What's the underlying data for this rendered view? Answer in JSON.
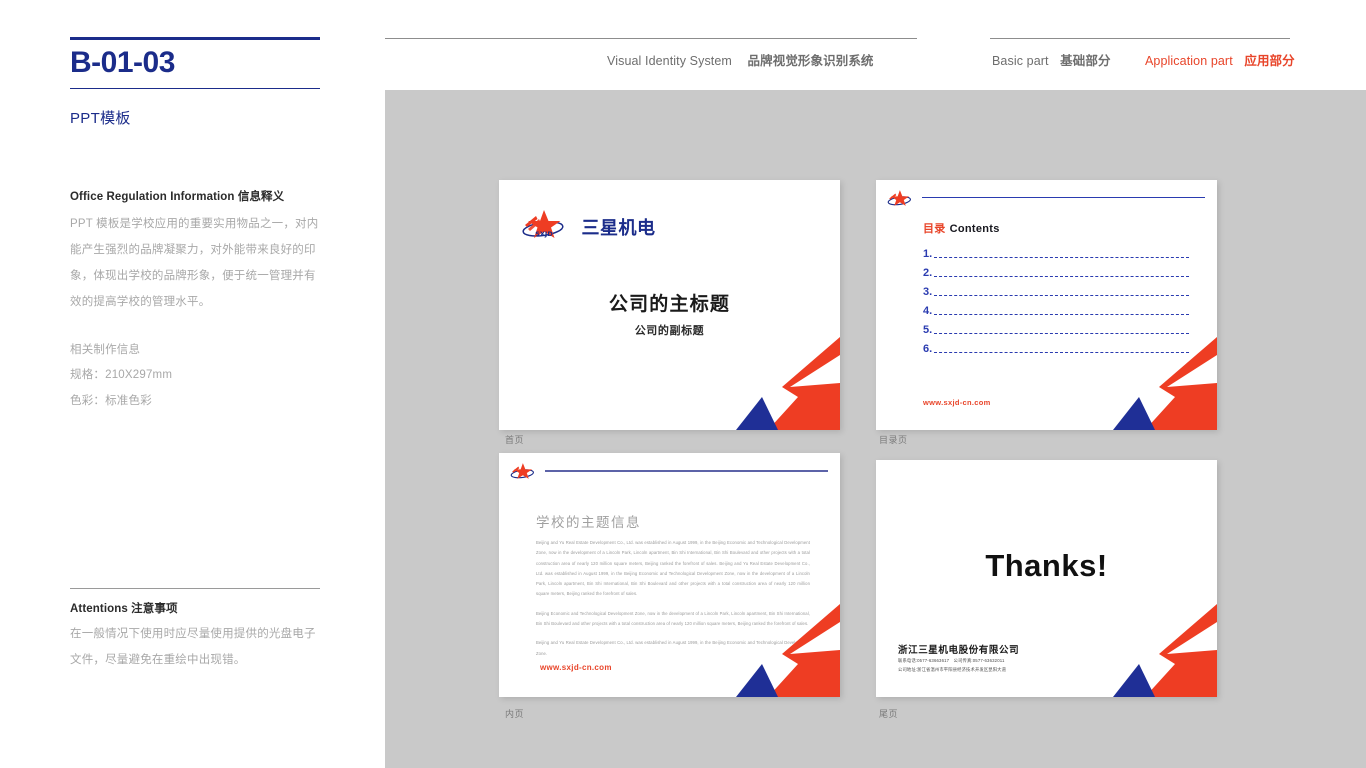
{
  "sidebar": {
    "code": "B-01-03",
    "subtitle": "PPT模板",
    "info": {
      "heading_en": "Office Regulation Information",
      "heading_cn": "信息释义",
      "body": "PPT 模板是学校应用的重要实用物品之一，对内能产生强烈的品牌凝聚力，对外能带来良好的印象，体现出学校的品牌形象，便于统一管理并有效的提高学校的管理水平。",
      "spec_heading": "相关制作信息",
      "spec_size": "规格：210X297mm",
      "spec_color": "色彩：标准色彩"
    },
    "attentions": {
      "heading_en": "Attentions",
      "heading_cn": "注意事项",
      "body": "在一般情况下使用时应尽量使用提供的光盘电子文件，尽量避免在重绘中出现错。"
    }
  },
  "header": {
    "vis_en": "Visual Identity System",
    "vis_cn": "品牌视觉形象识别系统",
    "basic_en": "Basic part",
    "basic_cn": "基础部分",
    "app_en": "Application part",
    "app_cn": "应用部分"
  },
  "colors": {
    "brand_blue": "#1b2c8a",
    "accent_red": "#e8452a",
    "canvas_gray": "#c9c9c9",
    "deco_red": "#ee3d23",
    "deco_blue": "#1f2f96"
  },
  "slides": [
    {
      "caption": "首页",
      "logo_word": "三星机电",
      "logo_sub": "SXJD",
      "title": "公司的主标题",
      "subtitle": "公司的副标题"
    },
    {
      "caption": "目录页",
      "head_cn": "目录",
      "head_en": "Contents",
      "items": [
        "1.",
        "2.",
        "3.",
        "4.",
        "5.",
        "6."
      ],
      "url": "www.sxjd-cn.com"
    },
    {
      "caption": "内页",
      "title": "学校的主题信息",
      "para1": "Beijing and Yu Real Estate Development Co., Ltd. was established in August 1999, in the Beijing Economic and Technological Development Zone, now in the development of a Lincoln Park, Lincoln apartment, Bin Shi International, Bin Shi Boulevard and other projects with a total construction area of nearly 120 million square meters, Beijing ranked the forefront of sales. Beijing and Yu Real Estate Development Co., Ltd. was established in August 1999, in the Beijing Economic and Technological Development Zone, now in the development of a Lincoln Park, Lincoln apartment, Bin Shi International, Bin Shi Boulevard and other projects with a total construction area of nearly 120 million square meters, Beijing ranked the forefront of sales.",
      "para2": "Beijing Economic and Technological Development Zone, now in the development of a Lincoln Park, Lincoln apartment, Bin Shi International, Bin Shi Boulevard and other projects with a total construction area of nearly 120 million square meters, Beijing ranked the forefront of sales.",
      "para3": "Beijing and Yu Real Estate Development Co., Ltd. was established in August 1999, in the Beijing Economic and Technological Development Zone.",
      "url": "www.sxjd-cn.com"
    },
    {
      "caption": "尾页",
      "thanks": "Thanks!",
      "company": "浙江三星机电股份有限公司",
      "contact": "联系电话:0577-63663617　公司传真:0577-63632011",
      "address": "公司地址:浙江省温州市平阳县经济技术开发区昆阳大道"
    }
  ]
}
